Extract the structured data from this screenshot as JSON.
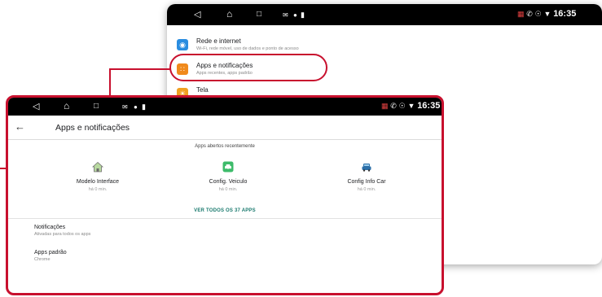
{
  "colors": {
    "highlight": "#c8102e",
    "status_bar": "#000000",
    "accent_teal": "#1a7a6e",
    "wifi_icon": "#2a8de0",
    "apps_icon": "#f08a1c",
    "display_icon": "#f0a020"
  },
  "back_screen": {
    "status_bar": {
      "nav_icons": [
        "back-triangle-icon",
        "home-icon",
        "recents-icon"
      ],
      "notification_icons": [
        "message-icon",
        "location-icon",
        "battery-icon"
      ],
      "right_icons": [
        "no-signal-icon",
        "phone-icon",
        "location-icon",
        "wifi-icon"
      ],
      "time": "16:35"
    },
    "settings_items": [
      {
        "title": "Rede e internet",
        "subtitle": "Wi-Fi, rede móvel, uso de dados e ponto de acesso",
        "icon": "wifi-icon"
      },
      {
        "title": "Apps e notificações",
        "subtitle": "Apps recentes, apps padrão",
        "icon": "apps-grid-icon"
      },
      {
        "title": "Tela",
        "subtitle": "",
        "icon": "display-icon"
      }
    ]
  },
  "front_screen": {
    "status_bar": {
      "time": "16:35"
    },
    "title": "Apps e notificações",
    "recent_header": "Apps abertos recentemente",
    "recent_apps": [
      {
        "name": "Modelo Interface",
        "time": "há 0 min.",
        "icon": "home-icon"
      },
      {
        "name": "Config. Veiculo",
        "time": "há 0 min.",
        "icon": "car-settings-icon"
      },
      {
        "name": "Config Info Car",
        "time": "há 0 min.",
        "icon": "car-icon"
      }
    ],
    "see_all": "VER TODOS OS 37 APPS",
    "preferences": [
      {
        "title": "Notificações",
        "subtitle": "Ativadas para todos os apps"
      },
      {
        "title": "Apps padrão",
        "subtitle": "Chrome"
      }
    ]
  }
}
